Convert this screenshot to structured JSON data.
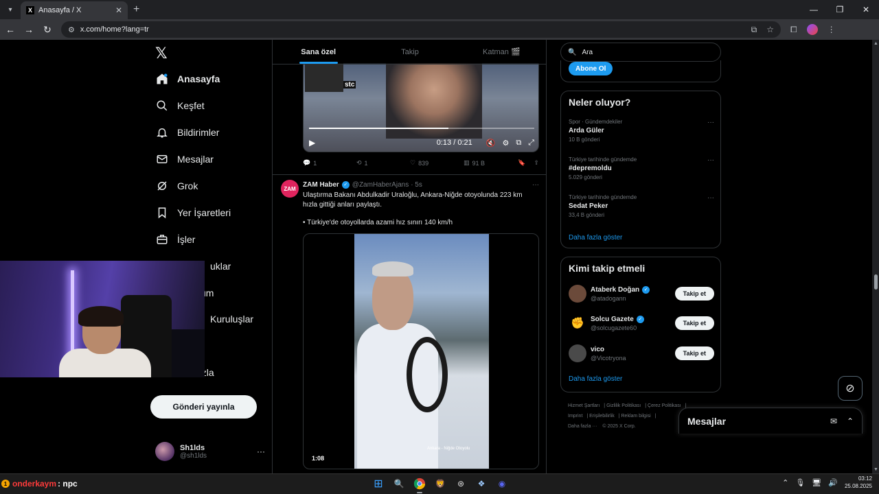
{
  "browser": {
    "tab_title": "Anasayfa / X",
    "url": "x.com/home?lang=tr"
  },
  "nav": {
    "items": [
      {
        "label": "Anasayfa",
        "icon": "home-icon",
        "active": true
      },
      {
        "label": "Keşfet",
        "icon": "search-icon"
      },
      {
        "label": "Bildirimler",
        "icon": "bell-icon"
      },
      {
        "label": "Mesajlar",
        "icon": "mail-icon"
      },
      {
        "label": "Grok",
        "icon": "grok-icon"
      },
      {
        "label": "Yer İşaretleri",
        "icon": "bookmark-icon"
      },
      {
        "label": "İşler",
        "icon": "briefcase-icon"
      },
      {
        "label": "uklar",
        "icon": "community-icon"
      },
      {
        "label": "um",
        "icon": "premium-icon"
      },
      {
        "label": "Kuruluşlar",
        "icon": "verified-org-icon"
      },
      {
        "label": "",
        "icon": "profile-icon"
      },
      {
        "label": "azla",
        "icon": "more-icon"
      }
    ],
    "post_button": "Gönderi yayınla",
    "me": {
      "name": "Sh1lds",
      "handle": "@sh1lds"
    }
  },
  "timeline": {
    "tabs": [
      "Sana özel",
      "Takip",
      "Katman 🎬"
    ],
    "video1": {
      "brand": "stc",
      "time": "0:13 / 0:21",
      "progress": 0.62
    },
    "tweet1_actions": {
      "replies": "1",
      "reposts": "1",
      "likes": "839",
      "views": "91 B"
    },
    "tweet2": {
      "avatar_text": "ZAM",
      "name": "ZAM Haber",
      "handle": "@ZamHaberAjans",
      "time": "· 5s",
      "text1": "Ulaştırma Bakanı Abdulkadir Uraloğlu, Ankara-Niğde otoyolunda 223 km hızla gittiği anları paylaştı.",
      "text2": "• Türkiye'de otoyollarda azami hız sınırı 140 km/h",
      "video_caption": "Ankara - Niğde Otoyolu",
      "duration": "1:08"
    }
  },
  "right": {
    "search_placeholder": "Ara",
    "subscribe": "Abone Ol",
    "trends_title": "Neler oluyor?",
    "trends": [
      {
        "meta": "Spor · Gündemdekiler",
        "topic": "Arda Güler",
        "count": "10 B gönderi"
      },
      {
        "meta": "Türkiye tarihinde gündemde",
        "topic": "#depremoldu",
        "count": "5.029 gönderi"
      },
      {
        "meta": "Türkiye tarihinde gündemde",
        "topic": "Sedat Peker",
        "count": "33,4 B gönderi"
      }
    ],
    "show_more": "Daha fazla göster",
    "wtf_title": "Kimi takip etmeli",
    "wtf": [
      {
        "name": "Ataberk Doğan",
        "handle": "@atadogann",
        "verified": true,
        "color": "#6b4a3a"
      },
      {
        "name": "Solcu Gazete",
        "handle": "@solcugazete60",
        "verified": true,
        "color": "#c8102e"
      },
      {
        "name": "vico",
        "handle": "@Vicotryona",
        "verified": false,
        "color": "#4a4a4a"
      }
    ],
    "follow_label": "Takip et",
    "footer": [
      "Hizmet Şartları",
      "Gizlilik Politikası",
      "Çerez Politikası",
      "Imprint",
      "Erişilebilirlik",
      "Reklam bilgisi",
      "Daha fazla ···",
      "© 2025 X Corp."
    ]
  },
  "messages_drawer": "Mesajlar",
  "taskbar": {
    "chat_badge": "1",
    "chat_user": "onderkaym",
    "chat_msg": ": npc",
    "time": "03:12",
    "date": "25.08.2025"
  }
}
